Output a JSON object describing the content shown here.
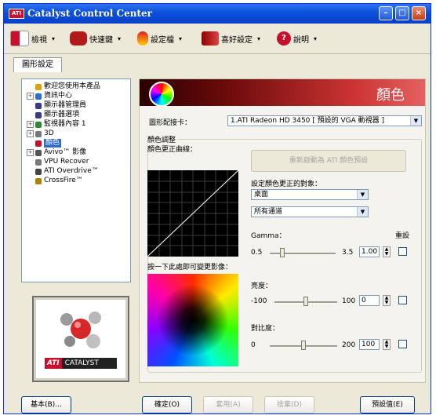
{
  "window": {
    "title": "Catalyst Control Center",
    "logo_text": "ATI"
  },
  "toolbar": [
    {
      "label": "檢視",
      "icon": "view-icon"
    },
    {
      "label": "快速鍵",
      "icon": "hotkeys-icon"
    },
    {
      "label": "設定檔",
      "icon": "profiles-icon"
    },
    {
      "label": "喜好設定",
      "icon": "preferences-icon"
    },
    {
      "label": "說明",
      "icon": "help-icon"
    }
  ],
  "tab": {
    "label": "圖形設定"
  },
  "tree": [
    {
      "label": "歡迎您使用本產品",
      "icon": "welcome-icon",
      "expand": ""
    },
    {
      "label": "資訊中心",
      "icon": "info-icon",
      "expand": "+"
    },
    {
      "label": "顯示器管理員",
      "icon": "display-manager-icon",
      "expand": ""
    },
    {
      "label": "顯示器選項",
      "icon": "display-options-icon",
      "expand": ""
    },
    {
      "label": "監視器內容 1",
      "icon": "monitor-icon",
      "expand": "+"
    },
    {
      "label": "3D",
      "icon": "3d-icon",
      "expand": "+"
    },
    {
      "label": "顏色",
      "icon": "arrow-icon",
      "expand": "",
      "selected": true
    },
    {
      "label": "Avivo™ 影像",
      "icon": "avivo-icon",
      "expand": "+"
    },
    {
      "label": "VPU Recover",
      "icon": "vpu-icon",
      "expand": ""
    },
    {
      "label": "ATI Overdrive™",
      "icon": "overdrive-icon",
      "expand": ""
    },
    {
      "label": "CrossFire™",
      "icon": "crossfire-icon",
      "expand": ""
    }
  ],
  "logo": {
    "brand": "ATI",
    "product": "CATALYST"
  },
  "content": {
    "banner_title": "顏色",
    "adapter_label": "圖形配接卡：",
    "adapter_value": "1.ATI Radeon HD 3450 [ 預設的 VGA 動視器 ]",
    "group_label": "顏色調整",
    "curve_label": "顏色更正曲線：",
    "palette_label": "按一下此處即可變更影像：",
    "reset_button": "重新啟動為 ATI 顏色預設",
    "target_label": "設定顏色更正的對象：",
    "target_value": "桌面",
    "channel_value": "所有通道",
    "reset_col": "重設",
    "gamma": {
      "label": "Gamma：",
      "min": "0.5",
      "max": "3.5",
      "value": "1.00",
      "fraction": 0.17
    },
    "brightness": {
      "label": "亮度：",
      "min": "-100",
      "max": "100",
      "value": "0",
      "fraction": 0.5
    },
    "contrast": {
      "label": "對比度：",
      "min": "0",
      "max": "200",
      "value": "100",
      "fraction": 0.5
    }
  },
  "buttons": {
    "basic": "基本(B)...",
    "ok": "確定(O)",
    "apply": "套用(A)",
    "discard": "捨棄(D)",
    "defaults": "預設值(E)"
  }
}
